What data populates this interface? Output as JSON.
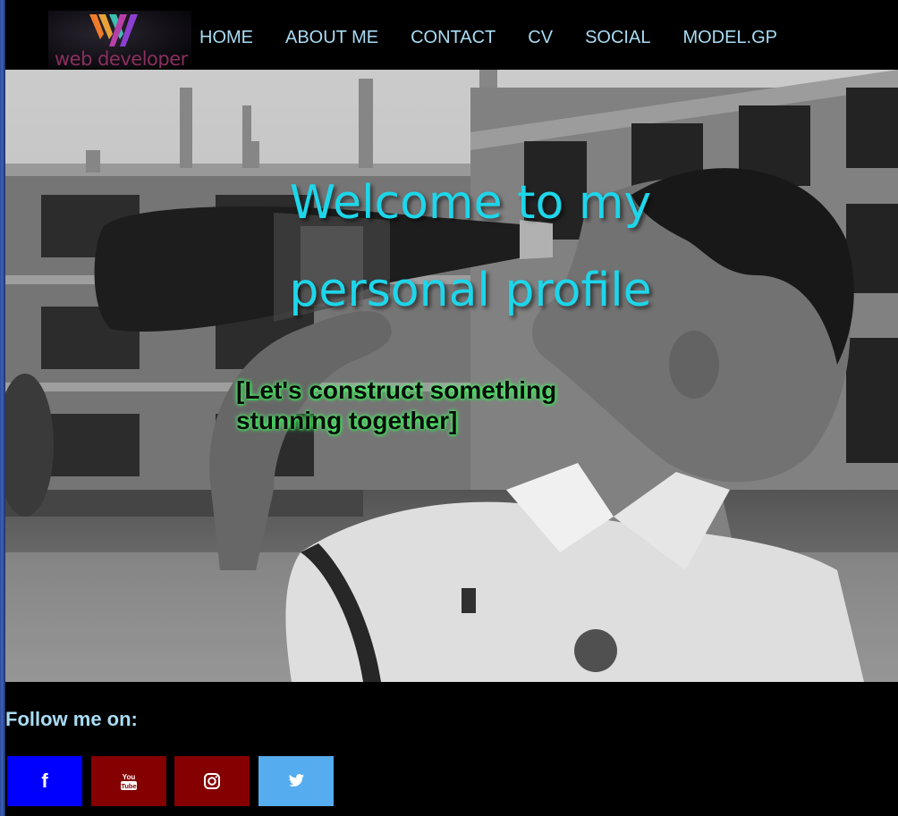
{
  "nav": {
    "logo_text": "web developer",
    "links": [
      "HOME",
      "ABOUT ME",
      "CONTACT",
      "CV",
      "SOCIAL",
      "MODEL.GP"
    ]
  },
  "hero": {
    "title": "Welcome to my personal profile",
    "subtitle": "[Let's construct something stunning together]"
  },
  "follow": {
    "title": "Follow me on:",
    "buttons": [
      {
        "icon": "facebook-icon",
        "color": "#0000ff"
      },
      {
        "icon": "youtube-icon",
        "color": "#850000"
      },
      {
        "icon": "instagram-icon",
        "color": "#850000"
      },
      {
        "icon": "twitter-icon",
        "color": "#55acee"
      }
    ]
  },
  "colors": {
    "nav_link": "#a9dcf4",
    "hero_title": "#1ed6ea",
    "subtitle_glow": "#4cff6a",
    "background": "#000000"
  }
}
